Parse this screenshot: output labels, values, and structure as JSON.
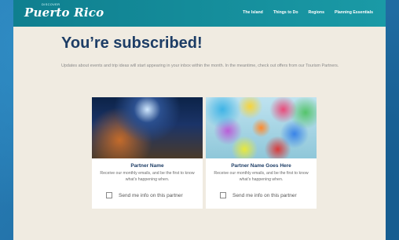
{
  "brand": {
    "logo_small": "DISCOVER",
    "logo_text": "Puerto Rico"
  },
  "nav": {
    "items": [
      "The Island",
      "Things to Do",
      "Regions",
      "Planning Essentials"
    ]
  },
  "main": {
    "title": "You’re subscribed!",
    "description": "Updates about events and trip ideas will start appearing in your inbox within the month. In the meantime, check out offers from our Tourism Partners."
  },
  "cards": [
    {
      "name": "Partner Name",
      "text": "Receive our monthly emails, and be the first to know what’s happening when.",
      "checkbox_label": "Send me info on this partner"
    },
    {
      "name": "Partner Name Goes Here",
      "text": "Receive our monthly emails, and be the first to know what’s happening when.",
      "checkbox_label": "Send me info on this partner"
    }
  ],
  "colors": {
    "header": "#149099",
    "title": "#1d3d66",
    "panel": "#f0ebe1"
  }
}
